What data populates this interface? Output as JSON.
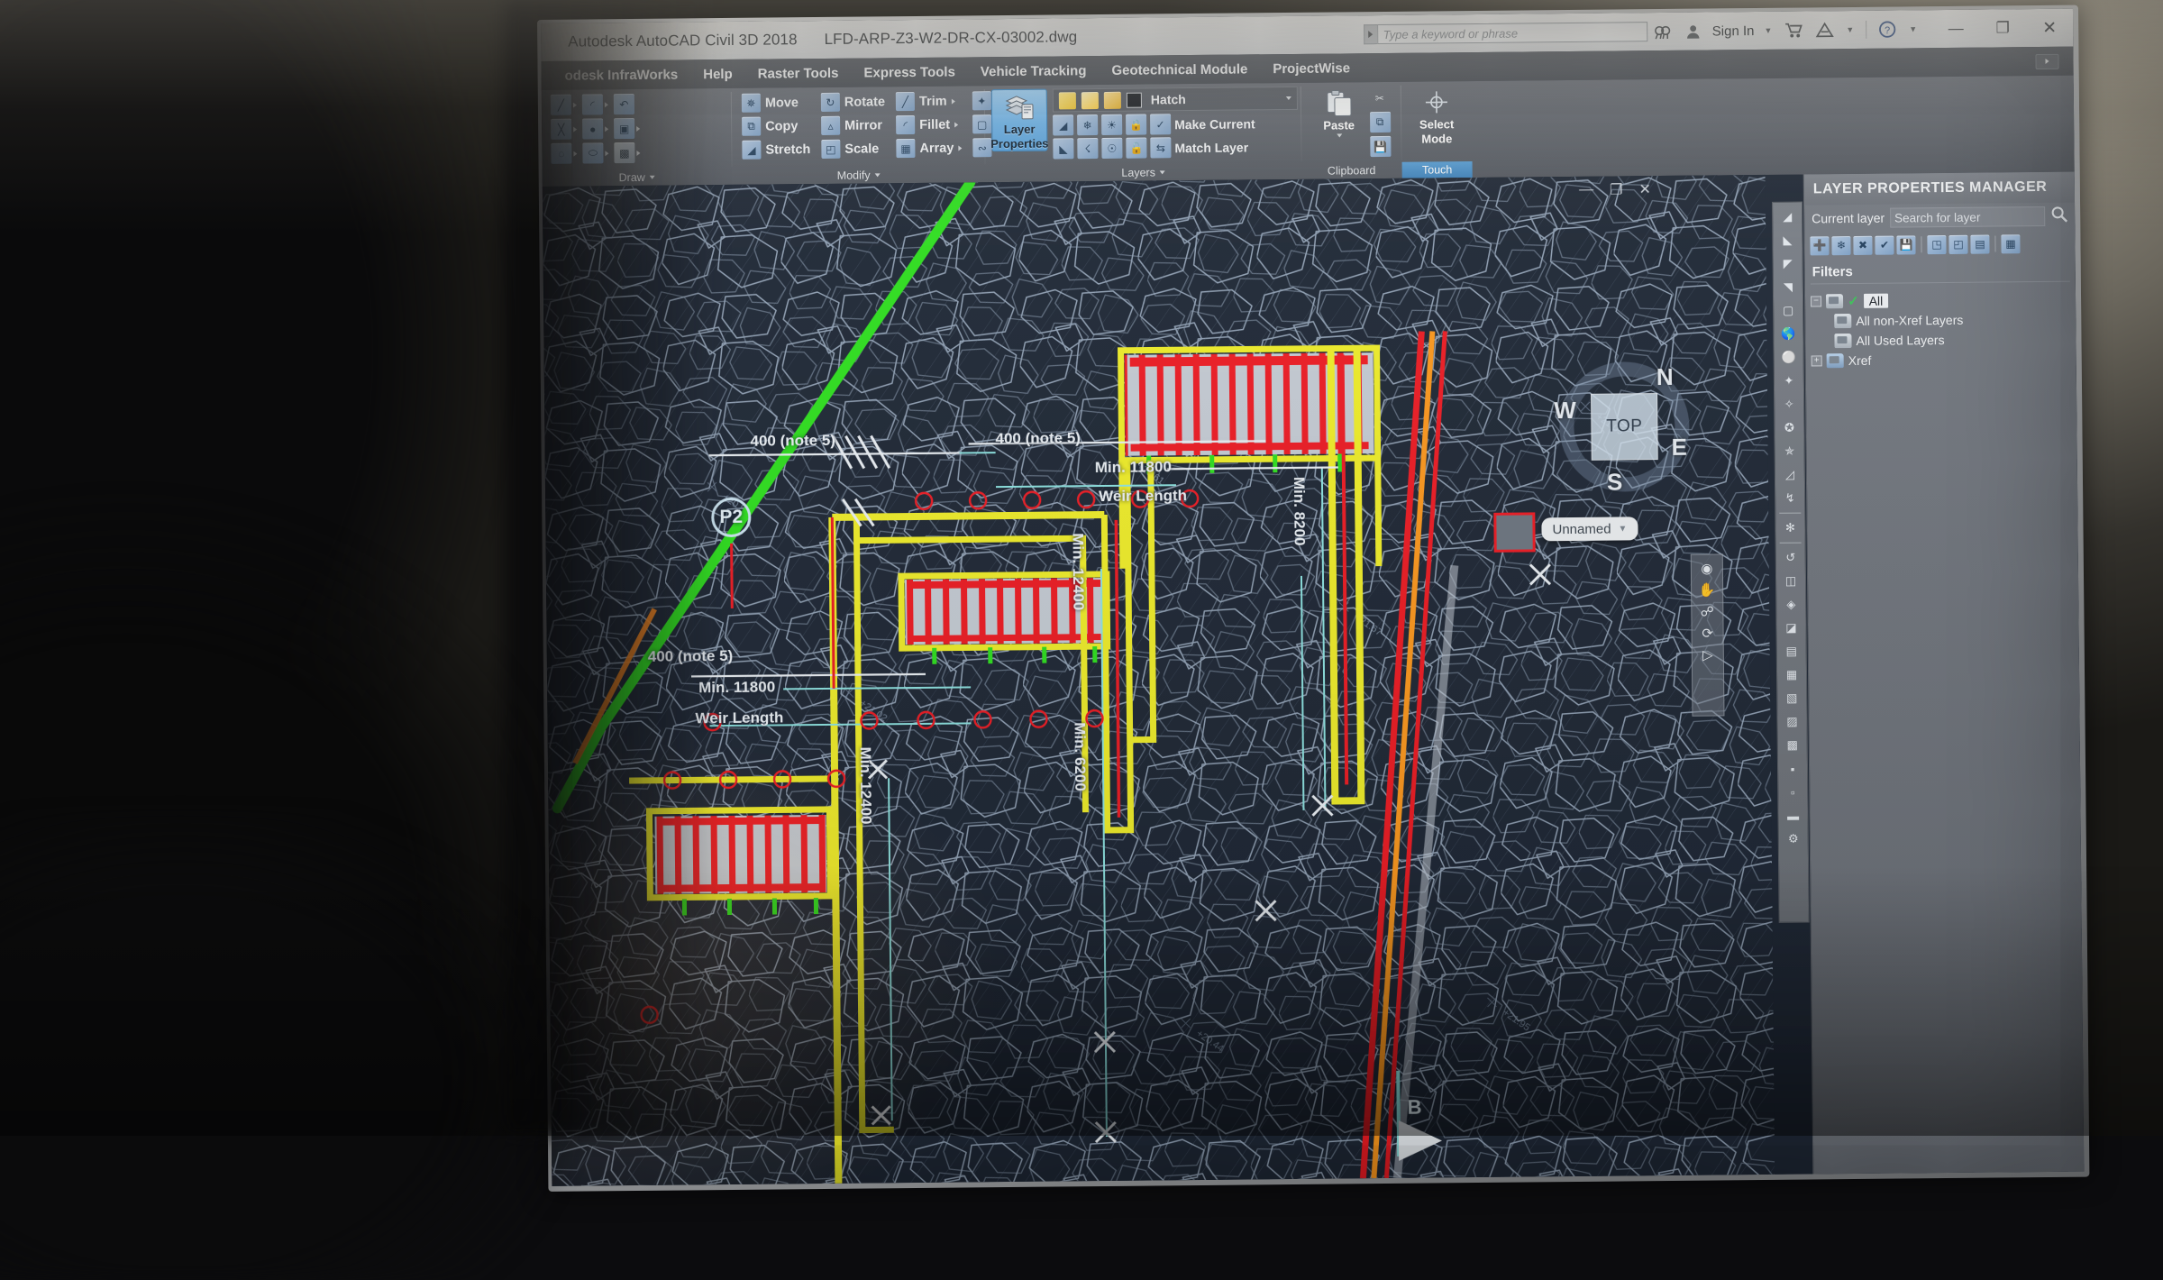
{
  "app": {
    "title": "Autodesk AutoCAD Civil 3D 2018",
    "file_name": "LFD-ARP-Z3-W2-DR-CX-03002.dwg",
    "search_placeholder": "Type a keyword or phrase",
    "sign_in": "Sign In",
    "window_controls": {
      "minimize": "—",
      "maximize": "❐",
      "close": "✕"
    },
    "icons": {
      "search": "search-icon",
      "account": "account-icon",
      "cart": "cart-icon",
      "autodesk": "autodesk-a-icon",
      "help": "help-question-icon"
    }
  },
  "menubar": {
    "items": [
      {
        "label": "odesk InfraWorks"
      },
      {
        "label": "Help"
      },
      {
        "label": "Raster Tools"
      },
      {
        "label": "Express Tools"
      },
      {
        "label": "Vehicle Tracking"
      },
      {
        "label": "Geotechnical Module"
      },
      {
        "label": "ProjectWise"
      }
    ]
  },
  "ribbon": {
    "panels": [
      {
        "name": "Draw",
        "label": "Draw",
        "icons": [
          {
            "name": "line-icon",
            "glyph": "╱"
          },
          {
            "name": "arc-icon",
            "glyph": "◜"
          },
          {
            "name": "polyline-icon",
            "glyph": "↶"
          },
          {
            "name": "construction-line-icon",
            "glyph": "✕"
          },
          {
            "name": "circle-icon",
            "glyph": "●"
          },
          {
            "name": "rectangle-icon",
            "glyph": "▣"
          },
          {
            "name": "revision-cloud-icon",
            "glyph": "◌"
          },
          {
            "name": "ellipse-icon",
            "glyph": "⬭"
          },
          {
            "name": "hatch-icon",
            "glyph": "░"
          }
        ]
      },
      {
        "name": "Modify",
        "label": "Modify",
        "buttons": [
          {
            "name": "move-button",
            "label": "Move",
            "icon": "move-icon",
            "glyph": "✥"
          },
          {
            "name": "rotate-button",
            "label": "Rotate",
            "icon": "rotate-icon",
            "glyph": "↻"
          },
          {
            "name": "trim-button",
            "label": "Trim",
            "icon": "trim-icon",
            "glyph": "✂"
          },
          {
            "name": "copy-button",
            "label": "Copy",
            "icon": "copy-icon",
            "glyph": "⧉"
          },
          {
            "name": "mirror-button",
            "label": "Mirror",
            "icon": "mirror-icon",
            "glyph": "△"
          },
          {
            "name": "fillet-button",
            "label": "Fillet",
            "icon": "fillet-icon",
            "glyph": "◜"
          },
          {
            "name": "stretch-button",
            "label": "Stretch",
            "icon": "stretch-icon",
            "glyph": "◢"
          },
          {
            "name": "scale-button",
            "label": "Scale",
            "icon": "scale-icon",
            "glyph": "◰"
          },
          {
            "name": "array-button",
            "label": "Array",
            "icon": "array-icon",
            "glyph": "▒"
          }
        ]
      },
      {
        "name": "Layers",
        "label": "Layers",
        "layer_properties_label": "Layer\nProperties",
        "layer_properties_line1": "Layer",
        "layer_properties_line2": "Properties",
        "layer_properties_active": true,
        "current_layer": "Hatch",
        "make_current": "Make Current",
        "match_layer": "Match Layer",
        "state_icons": [
          {
            "name": "layer-on-bulb-icon",
            "glyph": "●"
          },
          {
            "name": "layer-thaw-sun-icon",
            "glyph": "☀"
          },
          {
            "name": "layer-unlock-icon",
            "glyph": "⚿"
          }
        ]
      },
      {
        "name": "Clipboard",
        "label": "Clipboard",
        "paste_label": "Paste",
        "small": [
          {
            "name": "cut-icon",
            "glyph": "✂"
          },
          {
            "name": "copy-clip-icon",
            "glyph": "⧉"
          },
          {
            "name": "paste-special-icon",
            "glyph": "ὋE"
          }
        ]
      },
      {
        "name": "Touch",
        "label": "Touch",
        "select_mode_line1": "Select",
        "select_mode_line2": "Mode",
        "active": true
      }
    ]
  },
  "drawing_window": {
    "controls": {
      "minimize": "—",
      "restore": "❐",
      "close": "✕"
    },
    "viewcube": {
      "face": "TOP",
      "north": "N",
      "south": "S",
      "east": "E",
      "west": "W"
    },
    "tooltip": {
      "text": "Unnamed",
      "icon": "dropdown-caret-icon"
    },
    "section_marker": "B",
    "callouts": [
      {
        "name": "callout-p2",
        "label": "P2"
      }
    ],
    "annotations": [
      {
        "name": "dim-400-note5-a",
        "text": "400 (note 5)"
      },
      {
        "name": "dim-400-note5-b",
        "text": "400 (note 5)"
      },
      {
        "name": "dim-min-11800-a",
        "text": "Min. 11800"
      },
      {
        "name": "weir-length-a",
        "text": "Weir Length"
      },
      {
        "name": "dim-400-note5-c",
        "text": "400 (note 5)"
      },
      {
        "name": "dim-min-11800-b",
        "text": "Min. 11800"
      },
      {
        "name": "weir-length-b",
        "text": "Weir Length"
      },
      {
        "name": "dim-min-12400-a",
        "text": "Min. 12400"
      },
      {
        "name": "dim-min-6200",
        "text": "Min. 6200"
      },
      {
        "name": "dim-min-8200",
        "text": "Min. 8200"
      },
      {
        "name": "dim-min-12400-b",
        "text": "Min. 12400"
      }
    ],
    "colors": {
      "background": "#1f2836",
      "rock_outline": "#9fb0c4",
      "concrete_yellow": "#f2f02a",
      "rebar_red": "#f01c24",
      "alignment_green": "#2fe21f",
      "dimension_cyan": "#8fe6e4",
      "hatch_gray": "#c7ced6",
      "annotation_white": "#eef3f8"
    }
  },
  "layer_properties_manager": {
    "title": "LAYER PROPERTIES MANAGER",
    "current_layer_label": "Current layer",
    "search_placeholder": "Search for layer",
    "search_icon": "search-icon",
    "filters_label": "Filters",
    "toolbar_icons": [
      {
        "name": "new-layer-icon",
        "glyph": "➕"
      },
      {
        "name": "new-layer-vp-frozen-icon",
        "glyph": "❄"
      },
      {
        "name": "delete-layer-icon",
        "glyph": "✖"
      },
      {
        "name": "set-current-icon",
        "glyph": "✔"
      },
      {
        "name": "layer-states-icon",
        "glyph": "ὋE"
      },
      {
        "name": "new-property-filter-icon",
        "glyph": "◱"
      },
      {
        "name": "new-group-filter-icon",
        "glyph": "◰"
      },
      {
        "name": "layer-states-manager-icon",
        "glyph": "▤"
      },
      {
        "name": "layer-walk-icon",
        "glyph": "▦"
      }
    ],
    "tree": [
      {
        "name": "filter-node-all",
        "label": "All",
        "selected": true,
        "checked": true,
        "expander": "−",
        "indent": 0
      },
      {
        "name": "filter-node-all-non-xref",
        "label": "All non-Xref Layers",
        "indent": 1
      },
      {
        "name": "filter-node-all-used",
        "label": "All Used Layers",
        "indent": 1
      },
      {
        "name": "filter-node-xref",
        "label": "Xref",
        "expander": "+",
        "indent": 0
      }
    ]
  }
}
